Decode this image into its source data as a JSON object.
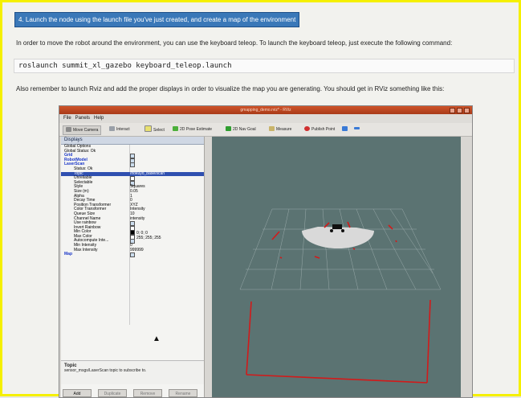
{
  "doc": {
    "step_label": "4. Launch the node using the launch file you've just created, and create a map of the environment",
    "para1": "In order to move the robot around the environment, you can use the keyboard teleop. To launch the keyboard teleop, just execute the following command:",
    "command": "roslaunch summit_xl_gazebo keyboard_teleop.launch",
    "para2": "Also remember to launch Rviz and add the proper displays in order to visualize the map you are generating. You should get in RViz something like this:"
  },
  "rviz": {
    "window_title": "gmapping_demo.rviz* - RViz",
    "menu": [
      "File",
      "Panels",
      "Help"
    ],
    "tools": [
      "Move Camera",
      "Interact",
      "Select",
      "2D Pose Estimate",
      "2D Nav Goal",
      "Measure",
      "Publish Point"
    ],
    "displays_title": "Displays",
    "tree": [
      {
        "indent": 0,
        "key": "Global Options",
        "style": ""
      },
      {
        "indent": 0,
        "key": "Global Status: Ok",
        "style": ""
      },
      {
        "indent": 0,
        "key": "Grid",
        "style": "blue",
        "check": true
      },
      {
        "indent": 0,
        "key": "RobotModel",
        "style": "blue",
        "check": true
      },
      {
        "indent": 0,
        "key": "LaserScan",
        "style": "blue",
        "check": true
      },
      {
        "indent": 1,
        "key": "Status: Ok",
        "style": ""
      },
      {
        "indent": 1,
        "key": "Topic",
        "value": "/hokuyo_base/scan",
        "style": "sel"
      },
      {
        "indent": 1,
        "key": "Unreliable",
        "check": false
      },
      {
        "indent": 1,
        "key": "Selectable",
        "check": true
      },
      {
        "indent": 1,
        "key": "Style",
        "value": "Squares"
      },
      {
        "indent": 1,
        "key": "Size (m)",
        "value": "0.05"
      },
      {
        "indent": 1,
        "key": "Alpha",
        "value": "1"
      },
      {
        "indent": 1,
        "key": "Decay Time",
        "value": "0"
      },
      {
        "indent": 1,
        "key": "Position Transformer",
        "value": "XYZ"
      },
      {
        "indent": 1,
        "key": "Color Transformer",
        "value": "Intensity"
      },
      {
        "indent": 1,
        "key": "Queue Size",
        "value": "10"
      },
      {
        "indent": 1,
        "key": "Channel Name",
        "value": "intensity"
      },
      {
        "indent": 1,
        "key": "Use rainbow",
        "check": true
      },
      {
        "indent": 1,
        "key": "Invert Rainbow",
        "check": false
      },
      {
        "indent": 1,
        "key": "Min Color",
        "value": "0; 0; 0",
        "swatch": "#000000"
      },
      {
        "indent": 1,
        "key": "Max Color",
        "value": "255; 255; 255",
        "swatch": "#ffffff"
      },
      {
        "indent": 1,
        "key": "Autocompute Inte...",
        "check": true
      },
      {
        "indent": 1,
        "key": "Min Intensity",
        "value": "0"
      },
      {
        "indent": 1,
        "key": "Max Intensity",
        "value": "999999"
      },
      {
        "indent": 0,
        "key": "Map",
        "style": "blue",
        "check": true
      }
    ],
    "desc_title": "Topic",
    "desc_text": "sensor_msgs/LaserScan topic to subscribe to.",
    "buttons": [
      "Add",
      "Duplicate",
      "Remove",
      "Rename"
    ],
    "colors": {
      "scan": "#d21a1a",
      "grid": "#a8b8b8",
      "map": "#d9d9d9",
      "view_bg": "#5b7372"
    }
  }
}
